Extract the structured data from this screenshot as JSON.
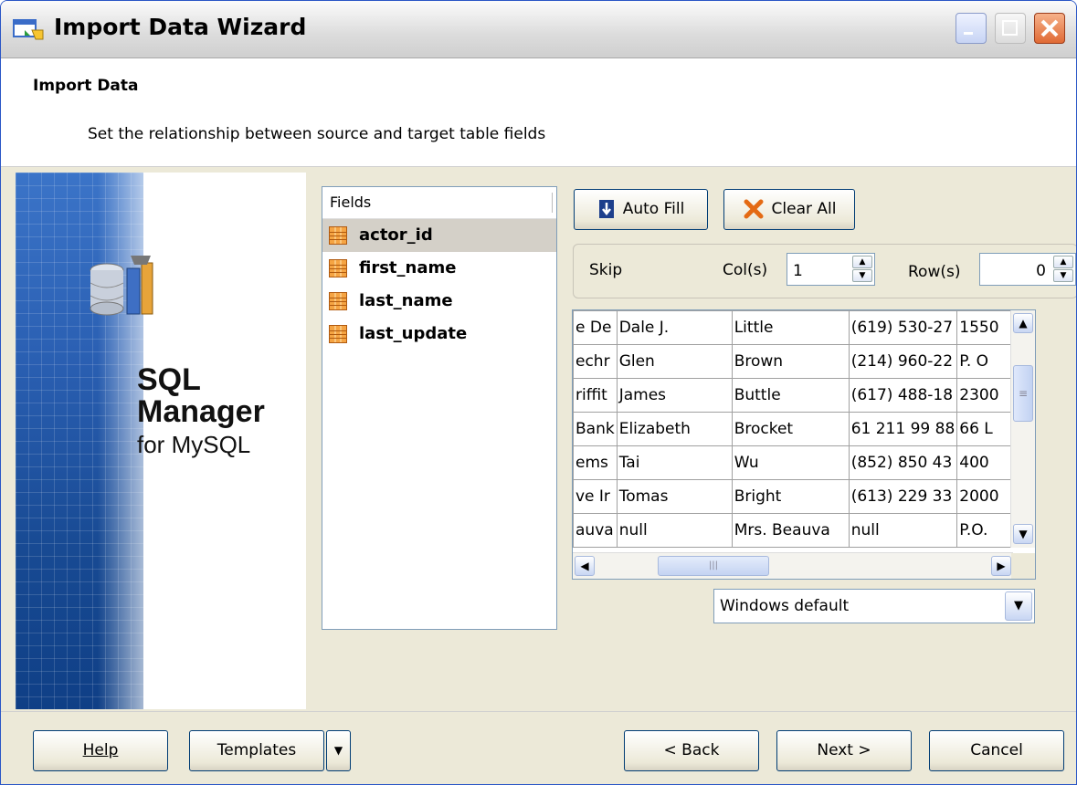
{
  "window": {
    "title": "Import Data Wizard"
  },
  "header": {
    "title": "Import Data",
    "subtitle": "Set the relationship between source and target table fields"
  },
  "banner": {
    "product_line1": "SQL",
    "product_line2": "Manager",
    "product_line3": "for MySQL"
  },
  "fields": {
    "header": "Fields",
    "items": [
      "actor_id",
      "first_name",
      "last_name",
      "last_update"
    ],
    "selected": "actor_id"
  },
  "toolbar": {
    "auto_fill_label": "Auto Fill",
    "clear_all_label": "Clear All"
  },
  "skip": {
    "label": "Skip",
    "cols_label": "Col(s)",
    "cols_value": "1",
    "rows_label": "Row(s)",
    "rows_value": "0"
  },
  "preview": {
    "rows": [
      [
        "e De",
        "Dale J.",
        "Little",
        "(619) 530-27",
        "1550"
      ],
      [
        "echr",
        "Glen",
        "Brown",
        "(214) 960-22",
        "P. O"
      ],
      [
        "riffit",
        "James",
        "Buttle",
        "(617) 488-18",
        "2300"
      ],
      [
        "Bank",
        "Elizabeth",
        "Brocket",
        "61 211 99 88",
        "66 L"
      ],
      [
        "ems",
        "Tai",
        "Wu",
        "(852) 850 43",
        "400"
      ],
      [
        "ve Ir",
        "Tomas",
        "Bright",
        "(613) 229 33",
        "2000"
      ],
      [
        "auva",
        "null",
        "Mrs. Beauva",
        "null",
        "P.O."
      ]
    ]
  },
  "encoding": {
    "value": "Windows default"
  },
  "footer": {
    "help_label": "Help",
    "templates_label": "Templates",
    "back_label": "< Back",
    "next_label": "Next >",
    "cancel_label": "Cancel"
  }
}
